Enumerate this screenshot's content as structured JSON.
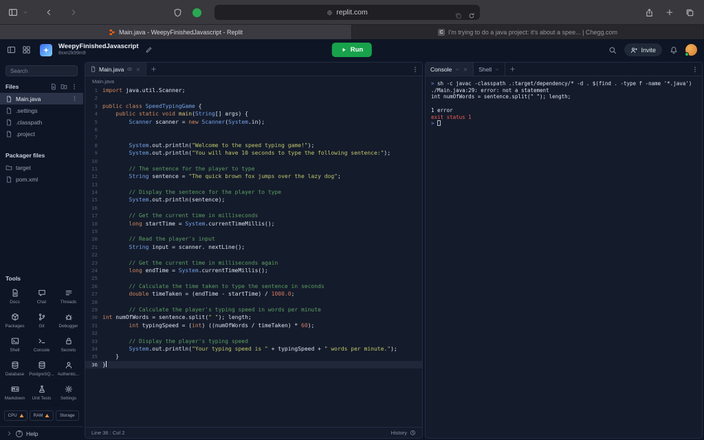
{
  "browser": {
    "url": "replit.com",
    "tabs": [
      {
        "title": "Main.java - WeepyFinishedJavascript - Replit"
      },
      {
        "title": "I'm trying to do a java project: it's about a spee... | Chegg.com",
        "favicon_letter": "C"
      }
    ]
  },
  "header": {
    "workspace_name": "WeepyFinishedJavascript",
    "workspace_id": "8xxn2k99m9",
    "run_label": "Run",
    "invite_label": "Invite"
  },
  "sidebar": {
    "search_placeholder": "Search",
    "files_header": "Files",
    "files": [
      {
        "name": "Main.java",
        "icon": "java-file",
        "active": true
      },
      {
        "name": ".settings",
        "icon": "file"
      },
      {
        "name": ".classpath",
        "icon": "file"
      },
      {
        "name": ".project",
        "icon": "file"
      }
    ],
    "packager_header": "Packager files",
    "packager_files": [
      {
        "name": "target",
        "icon": "folder"
      },
      {
        "name": "pom.xml",
        "icon": "file"
      }
    ],
    "tools_header": "Tools",
    "tools": [
      {
        "label": "Docs",
        "icon": "docs"
      },
      {
        "label": "Chat",
        "icon": "chat"
      },
      {
        "label": "Threads",
        "icon": "threads"
      },
      {
        "label": "Packages",
        "icon": "package"
      },
      {
        "label": "Git",
        "icon": "git"
      },
      {
        "label": "Debugger",
        "icon": "debugger"
      },
      {
        "label": "Shell",
        "icon": "shell"
      },
      {
        "label": "Console",
        "icon": "console"
      },
      {
        "label": "Secrets",
        "icon": "lock"
      },
      {
        "label": "Database",
        "icon": "database"
      },
      {
        "label": "PostgreSQ...",
        "icon": "database"
      },
      {
        "label": "Authentic...",
        "icon": "person"
      },
      {
        "label": "Markdown",
        "icon": "markdown"
      },
      {
        "label": "Unit Tests",
        "icon": "flask"
      },
      {
        "label": "Settings",
        "icon": "gear"
      }
    ],
    "meters": [
      {
        "label": "CPU",
        "warning": true
      },
      {
        "label": "RAM",
        "warning": true
      },
      {
        "label": "Storage",
        "warning": false
      }
    ],
    "help_label": "Help"
  },
  "editor": {
    "tab_label": "Main.java",
    "breadcrumb": "Main.java",
    "status_line": "Line 36 : Col 2",
    "history_label": "History",
    "code_lines": [
      {
        "n": 1,
        "s": [
          [
            "kw",
            "import"
          ],
          [
            "pl",
            " java.util.Scanner;"
          ]
        ]
      },
      {
        "n": 2,
        "s": []
      },
      {
        "n": 3,
        "s": [
          [
            "kw",
            "public class"
          ],
          [
            "ty",
            " SpeedTypingGame"
          ],
          [
            "pl",
            " {"
          ]
        ]
      },
      {
        "n": 4,
        "s": [
          [
            "pl",
            "    "
          ],
          [
            "kw",
            "public static void"
          ],
          [
            "fn",
            " main"
          ],
          [
            "pl",
            "("
          ],
          [
            "ty",
            "String"
          ],
          [
            "pl",
            "[] args) {"
          ]
        ]
      },
      {
        "n": 5,
        "s": [
          [
            "pl",
            "        "
          ],
          [
            "ty",
            "Scanner"
          ],
          [
            "pl",
            " scanner = "
          ],
          [
            "kw",
            "new"
          ],
          [
            "pl",
            " "
          ],
          [
            "ty",
            "Scanner"
          ],
          [
            "pl",
            "("
          ],
          [
            "ty",
            "System"
          ],
          [
            "pl",
            ".in);"
          ]
        ]
      },
      {
        "n": 6,
        "s": []
      },
      {
        "n": 7,
        "s": []
      },
      {
        "n": 8,
        "s": [
          [
            "pl",
            "        "
          ],
          [
            "ty",
            "System"
          ],
          [
            "pl",
            ".out.println("
          ],
          [
            "st",
            "\"Welcome to the speed typing game!\""
          ],
          [
            "pl",
            ");"
          ]
        ]
      },
      {
        "n": 9,
        "s": [
          [
            "pl",
            "        "
          ],
          [
            "ty",
            "System"
          ],
          [
            "pl",
            ".out.println("
          ],
          [
            "st",
            "\"You will have 10 seconds to type the following sentence:\""
          ],
          [
            "pl",
            ");"
          ]
        ]
      },
      {
        "n": 10,
        "s": []
      },
      {
        "n": 11,
        "s": [
          [
            "pl",
            "        "
          ],
          [
            "cm",
            "// The sentence for the player to type"
          ]
        ]
      },
      {
        "n": 12,
        "s": [
          [
            "pl",
            "        "
          ],
          [
            "ty",
            "String"
          ],
          [
            "pl",
            " sentence = "
          ],
          [
            "st",
            "\"The quick brown fox jumps over the lazy dog\""
          ],
          [
            "pl",
            ";"
          ]
        ]
      },
      {
        "n": 13,
        "s": []
      },
      {
        "n": 14,
        "s": [
          [
            "pl",
            "        "
          ],
          [
            "cm",
            "// Display the sentence for the player to type"
          ]
        ]
      },
      {
        "n": 15,
        "s": [
          [
            "pl",
            "        "
          ],
          [
            "ty",
            "System"
          ],
          [
            "pl",
            ".out.println(sentence);"
          ]
        ]
      },
      {
        "n": 16,
        "s": []
      },
      {
        "n": 17,
        "s": [
          [
            "pl",
            "        "
          ],
          [
            "cm",
            "// Get the current time in milliseconds"
          ]
        ]
      },
      {
        "n": 18,
        "s": [
          [
            "pl",
            "        "
          ],
          [
            "kw",
            "long"
          ],
          [
            "pl",
            " startTime = "
          ],
          [
            "ty",
            "System"
          ],
          [
            "pl",
            ".currentTimeMillis();"
          ]
        ]
      },
      {
        "n": 19,
        "s": []
      },
      {
        "n": 20,
        "s": [
          [
            "pl",
            "        "
          ],
          [
            "cm",
            "// Read the player's input"
          ]
        ]
      },
      {
        "n": 21,
        "s": [
          [
            "pl",
            "        "
          ],
          [
            "ty",
            "String"
          ],
          [
            "pl",
            " input = scanner. nextLine();"
          ]
        ]
      },
      {
        "n": 22,
        "s": []
      },
      {
        "n": 23,
        "s": [
          [
            "pl",
            "        "
          ],
          [
            "cm",
            "// Get the current time in milliseconds again"
          ]
        ]
      },
      {
        "n": 24,
        "s": [
          [
            "pl",
            "        "
          ],
          [
            "kw",
            "long"
          ],
          [
            "pl",
            " endTime = "
          ],
          [
            "ty",
            "System"
          ],
          [
            "pl",
            ".currentTimeMillis();"
          ]
        ]
      },
      {
        "n": 25,
        "s": []
      },
      {
        "n": 26,
        "s": [
          [
            "pl",
            "        "
          ],
          [
            "cm",
            "// Calculate the time taken to type the sentence in seconds"
          ]
        ]
      },
      {
        "n": 27,
        "s": [
          [
            "pl",
            "        "
          ],
          [
            "kw",
            "double"
          ],
          [
            "pl",
            " timeTaken = (endTime - startTime) / "
          ],
          [
            "nu",
            "1000.0"
          ],
          [
            "pl",
            ";"
          ]
        ]
      },
      {
        "n": 28,
        "s": []
      },
      {
        "n": 29,
        "s": [
          [
            "pl",
            "        "
          ],
          [
            "cm",
            "// Calculate the player's typing speed in words per minute"
          ]
        ]
      },
      {
        "n": 30,
        "s": [
          [
            "kw",
            "int"
          ],
          [
            "pl",
            " numOfWords = sentence.split("
          ],
          [
            "st",
            "\" \""
          ],
          [
            "pl",
            "); length;"
          ]
        ]
      },
      {
        "n": 31,
        "s": [
          [
            "pl",
            "        "
          ],
          [
            "kw",
            "int"
          ],
          [
            "pl",
            " typingSpeed = ("
          ],
          [
            "kw",
            "int"
          ],
          [
            "pl",
            ") ((numOfWords / timeTaken) * "
          ],
          [
            "nu",
            "60"
          ],
          [
            "pl",
            ");"
          ]
        ]
      },
      {
        "n": 32,
        "s": []
      },
      {
        "n": 33,
        "s": [
          [
            "pl",
            "        "
          ],
          [
            "cm",
            "// Display the player's typing speed"
          ]
        ]
      },
      {
        "n": 34,
        "s": [
          [
            "pl",
            "        "
          ],
          [
            "ty",
            "System"
          ],
          [
            "pl",
            ".out.println("
          ],
          [
            "st",
            "\"Your typing speed is \""
          ],
          [
            "pl",
            " + typingSpeed + "
          ],
          [
            "st",
            "\" words per minute.\""
          ],
          [
            "pl",
            ");"
          ]
        ]
      },
      {
        "n": 35,
        "s": [
          [
            "pl",
            "    }"
          ]
        ]
      },
      {
        "n": 36,
        "s": [
          [
            "pl",
            "}"
          ]
        ],
        "cur": true
      }
    ]
  },
  "console": {
    "tab1_label": "Console",
    "tab2_label": "Shell",
    "lines": [
      {
        "s": [
          [
            "pr",
            "> "
          ],
          [
            "pl",
            "sh -c javac -classpath .:target/dependency/* -d . $(find . -type f -name '*.java')"
          ]
        ]
      },
      {
        "s": [
          [
            "pl",
            "./Main.java:29: error: not a statement"
          ]
        ]
      },
      {
        "s": [
          [
            "pl",
            "int numOfWords = sentence.split(\" \"); length;"
          ]
        ]
      },
      {
        "s": []
      },
      {
        "s": [
          [
            "pl",
            "1 error"
          ]
        ]
      },
      {
        "s": [
          [
            "er",
            "exit status 1"
          ]
        ]
      },
      {
        "s": [
          [
            "pr",
            "> "
          ]
        ],
        "cursor": true
      }
    ]
  }
}
